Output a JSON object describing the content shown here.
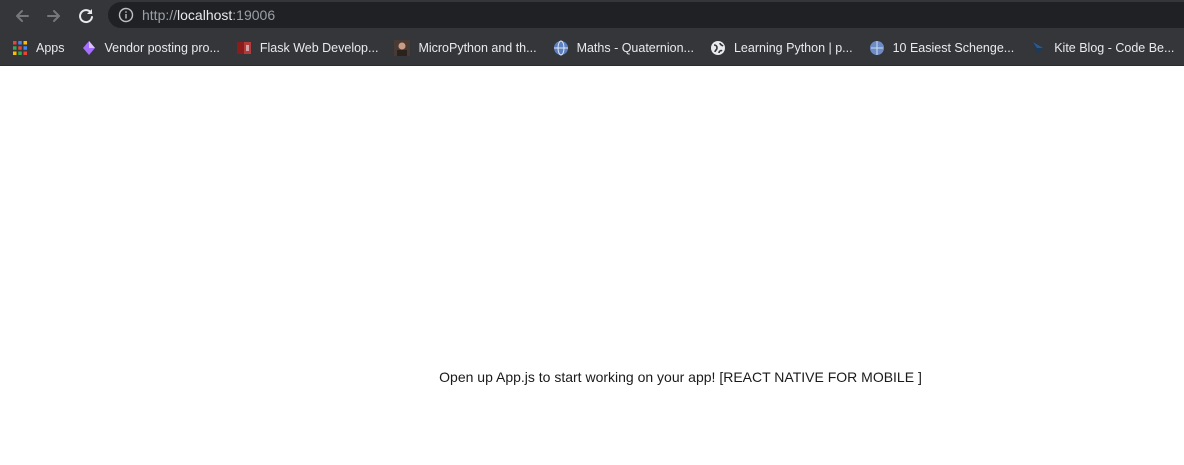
{
  "browser": {
    "url_scheme": "http://",
    "url_host": "localhost",
    "url_port": ":19006",
    "icon_back": "arrow-left-icon",
    "icon_forward": "arrow-right-icon",
    "icon_reload": "reload-icon",
    "icon_info": "info-icon"
  },
  "bookmarks": [
    {
      "label": "Apps",
      "icon": "apps-grid-icon"
    },
    {
      "label": "Vendor posting pro...",
      "icon": "purple-diamond-icon"
    },
    {
      "label": "Flask Web Develop...",
      "icon": "book-icon"
    },
    {
      "label": "MicroPython and th...",
      "icon": "avatar-icon"
    },
    {
      "label": "Maths - Quaternion...",
      "icon": "globe-icon"
    },
    {
      "label": "Learning Python | p...",
      "icon": "world-icon"
    },
    {
      "label": "10 Easiest Schenge...",
      "icon": "globe-icon"
    },
    {
      "label": "Kite Blog - Code Be...",
      "icon": "kite-icon"
    }
  ],
  "page": {
    "message": "Open up App.js to start working on your app! [REACT NATIVE FOR MOBILE ]"
  },
  "colors": {
    "toolbar": "#35363a",
    "omnibox": "#202124",
    "page_bg": "#ffffff"
  }
}
